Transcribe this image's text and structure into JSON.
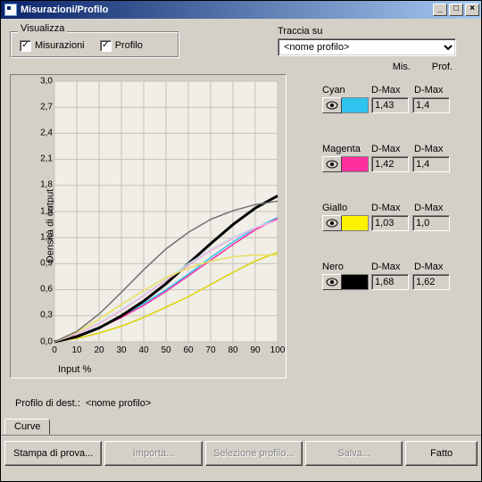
{
  "window_title": "Misurazioni/Profilo",
  "visualizza": {
    "label": "Visualizza",
    "misurazioni_label": "Misurazioni",
    "misurazioni_checked": true,
    "profilo_label": "Profilo",
    "profilo_checked": true
  },
  "traccia_su": {
    "label": "Traccia su",
    "selected": "<nome profilo>"
  },
  "side_headers": {
    "mis": "Mis.",
    "prof": "Prof."
  },
  "inks": [
    {
      "key": "cyan",
      "name": "Cyan",
      "color": "#2fc3f0",
      "mis_label": "D-Max",
      "mis_val": "1,43",
      "prof_label": "D-Max",
      "prof_val": "1,4"
    },
    {
      "key": "magenta",
      "name": "Magenta",
      "color": "#ff2fa0",
      "mis_label": "D-Max",
      "mis_val": "1,42",
      "prof_label": "D-Max",
      "prof_val": "1,4"
    },
    {
      "key": "giallo",
      "name": "Giallo",
      "color": "#fff200",
      "mis_label": "D-Max",
      "mis_val": "1,03",
      "prof_label": "D-Max",
      "prof_val": "1,0"
    },
    {
      "key": "nero",
      "name": "Nero",
      "color": "#000000",
      "mis_label": "D-Max",
      "mis_val": "1,68",
      "prof_label": "D-Max",
      "prof_val": "1,62"
    }
  ],
  "profile_dest": {
    "label": "Profilo di dest.:",
    "value": "<nome profilo>"
  },
  "tab_label": "Curve",
  "buttons": {
    "stampa": "Stampa di prova...",
    "importa": "Importa...",
    "seleziona": "Selezione profilo...",
    "salva": "Salva...",
    "fatto": "Fatto"
  },
  "chart_data": {
    "type": "line",
    "xlabel": "Input %",
    "ylabel": "Densità di output",
    "xlim": [
      0,
      100
    ],
    "ylim": [
      0,
      3.0
    ],
    "xticks": [
      0,
      10,
      20,
      30,
      40,
      50,
      60,
      70,
      80,
      90,
      100
    ],
    "yticks": [
      0,
      0.3,
      0.6,
      0.9,
      1.2,
      1.5,
      1.8,
      2.1,
      2.4,
      2.7,
      3.0
    ],
    "x": [
      0,
      10,
      20,
      30,
      40,
      50,
      60,
      70,
      80,
      90,
      100
    ],
    "series": [
      {
        "name": "cyan-mis",
        "color": "#2fc3f0",
        "values": [
          0,
          0.07,
          0.17,
          0.29,
          0.44,
          0.6,
          0.78,
          0.97,
          1.15,
          1.31,
          1.43
        ]
      },
      {
        "name": "magenta-mis",
        "color": "#ff2fa0",
        "values": [
          0,
          0.07,
          0.16,
          0.28,
          0.42,
          0.58,
          0.76,
          0.94,
          1.12,
          1.29,
          1.42
        ]
      },
      {
        "name": "giallo-mis",
        "color": "#dcd200",
        "values": [
          0,
          0.04,
          0.1,
          0.18,
          0.28,
          0.4,
          0.52,
          0.66,
          0.8,
          0.93,
          1.03
        ]
      },
      {
        "name": "nero-mis",
        "color": "#000000",
        "values": [
          0,
          0.06,
          0.16,
          0.3,
          0.47,
          0.67,
          0.9,
          1.13,
          1.35,
          1.54,
          1.68
        ],
        "stroke_width": 3
      },
      {
        "name": "cyan-prof",
        "color": "#b4e8f5",
        "values": [
          0,
          0.09,
          0.22,
          0.37,
          0.54,
          0.72,
          0.9,
          1.06,
          1.2,
          1.32,
          1.4
        ]
      },
      {
        "name": "magenta-prof",
        "color": "#f8b0da",
        "values": [
          0,
          0.09,
          0.21,
          0.36,
          0.53,
          0.71,
          0.88,
          1.05,
          1.19,
          1.31,
          1.4
        ]
      },
      {
        "name": "giallo-prof",
        "color": "#e8e060",
        "values": [
          0,
          0.11,
          0.26,
          0.43,
          0.59,
          0.74,
          0.85,
          0.93,
          0.98,
          1.0,
          1.0
        ]
      },
      {
        "name": "nero-prof",
        "color": "#707070",
        "values": [
          0,
          0.12,
          0.32,
          0.57,
          0.83,
          1.07,
          1.26,
          1.41,
          1.51,
          1.58,
          1.62
        ]
      }
    ]
  }
}
